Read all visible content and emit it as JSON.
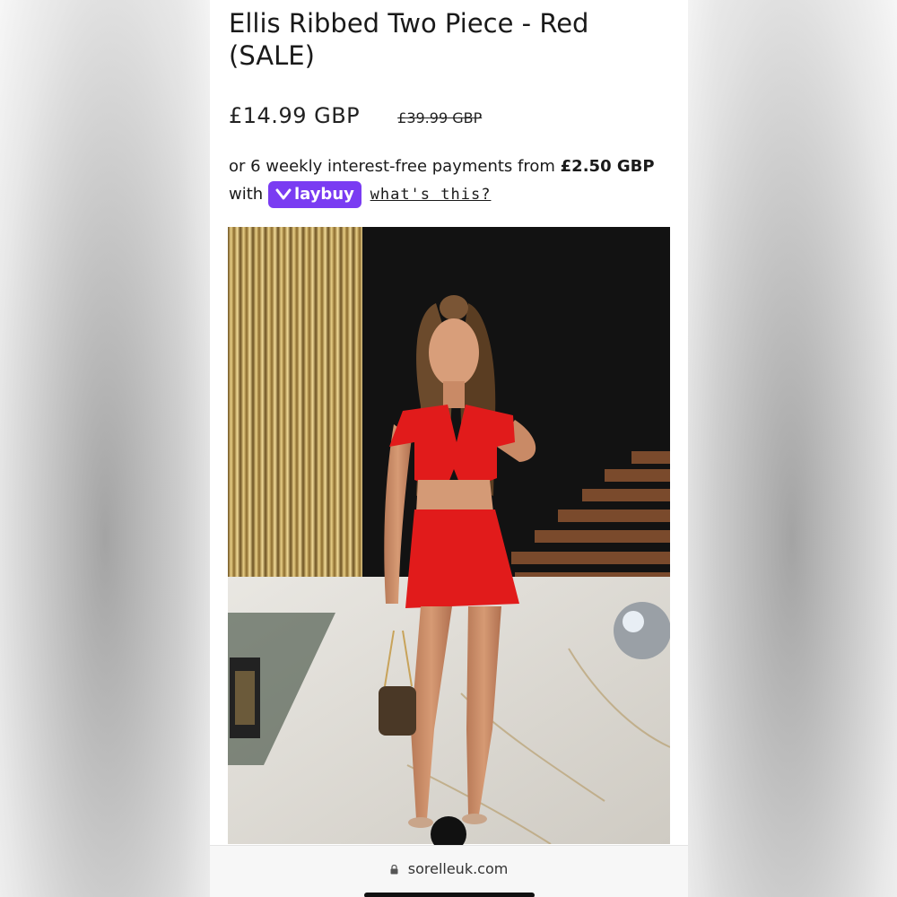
{
  "product": {
    "title": "Ellis Ribbed Two Piece - Red (SALE)",
    "sale_price": "£14.99 GBP",
    "original_price": "£39.99 GBP"
  },
  "installments": {
    "prefix": "or 6 weekly interest-free payments from",
    "amount": "£2.50 GBP",
    "with_label": "with",
    "provider": "laybuy",
    "info_link": "what's this?"
  },
  "colors": {
    "laybuy_purple": "#7a3cf2",
    "dress_red": "#e11b1b"
  },
  "browser": {
    "url": "sorelleuk.com",
    "lock_icon": "lock-icon"
  }
}
